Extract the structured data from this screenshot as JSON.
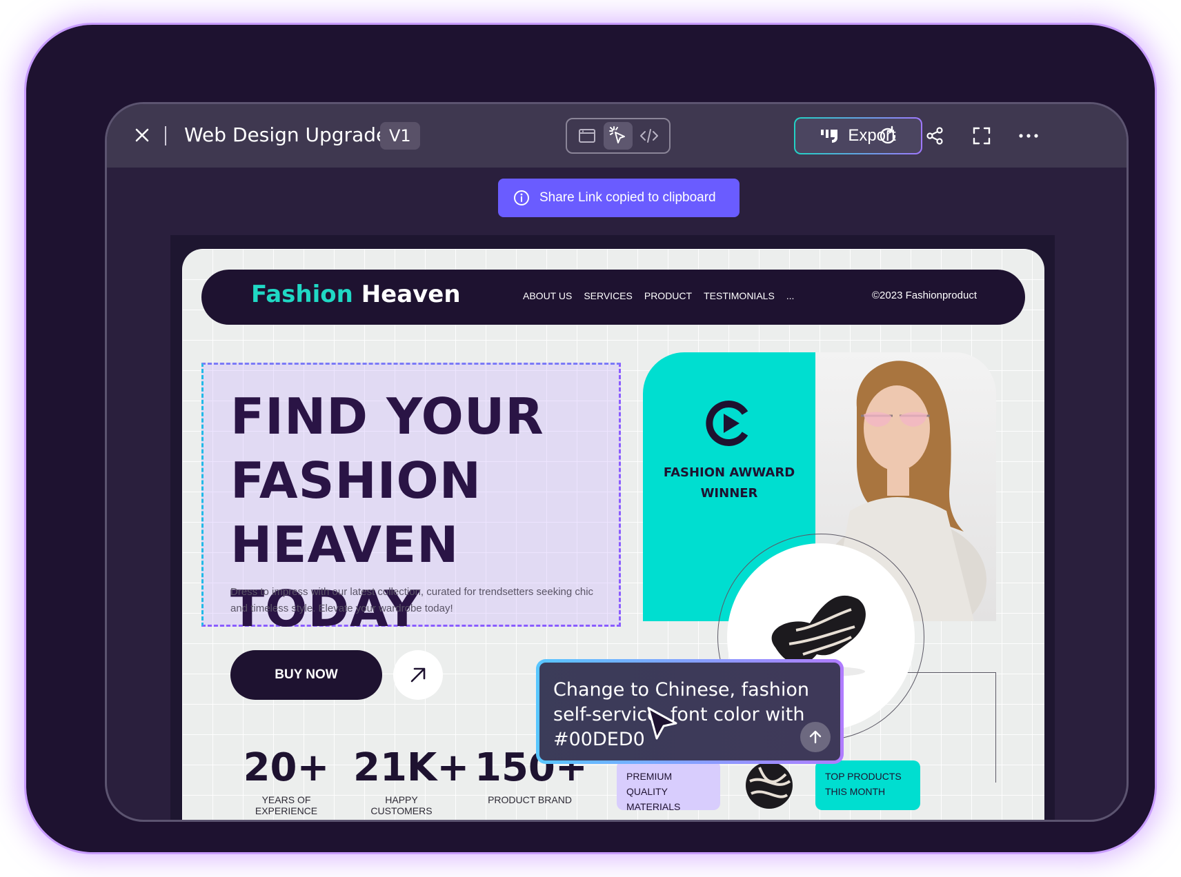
{
  "toolbar": {
    "title": "Web Design Upgrade",
    "version": "V1",
    "export_label": "Export",
    "icons": [
      "close-icon",
      "window-icon",
      "select-pointer-icon",
      "code-icon",
      "refresh-icon",
      "share-icon",
      "fullscreen-icon",
      "more-icon"
    ]
  },
  "toast": {
    "text": "Share Link copied to clipboard",
    "icon": "info-icon"
  },
  "site": {
    "logo_part1": "Fashion",
    "logo_part2": "Heaven",
    "nav": [
      "ABOUT US",
      "SERVICES",
      "PRODUCT",
      "TESTIMONIALS",
      "..."
    ],
    "copyright": "©2023 Fashionproduct",
    "hero_title": "FIND YOUR FASHION HEAVEN TODAY",
    "hero_desc": "Dress to impress with our latest collection, curated for trendsetters seeking chic and timeless style. Elevate your wardrobe today!",
    "buy_label": "BUY NOW",
    "stats": [
      {
        "num": "20+",
        "label": "YEARS OF EXPERIENCE"
      },
      {
        "num": "21K+",
        "label": "HAPPY CUSTOMERS"
      },
      {
        "num": "150+",
        "label": "PRODUCT BRAND"
      }
    ],
    "award": "FASHION AWWARD WINNER",
    "pill_left": "PREMIUM QUALITY MATERIALS",
    "pill_right": "TOP PRODUCTS THIS MONTH"
  },
  "prompt": {
    "text": "Change to Chinese, fashion self-service, font color with #00DED0"
  },
  "colors": {
    "accent_teal": "#00DED0",
    "dark": "#1E1230",
    "toast": "#6A5CFF"
  }
}
